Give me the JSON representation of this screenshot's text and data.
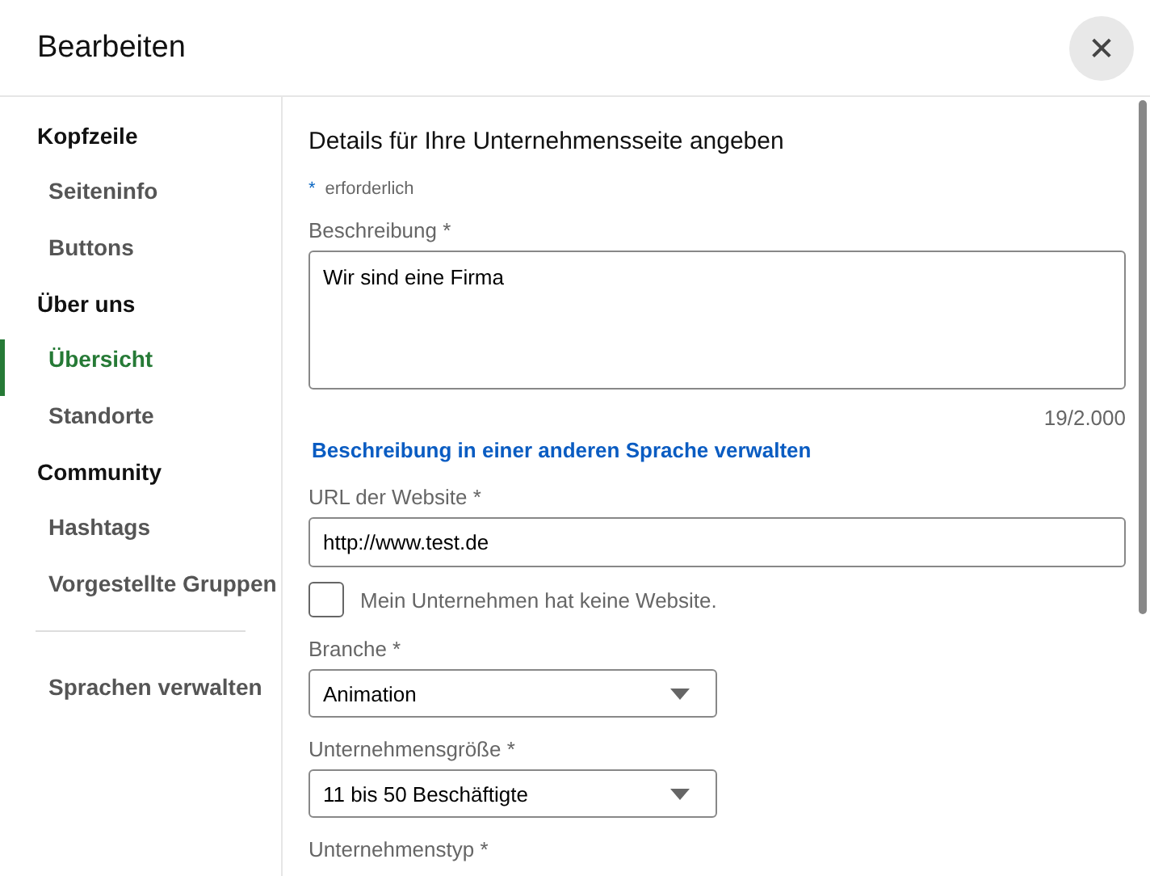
{
  "dialog": {
    "title": "Bearbeiten",
    "close": "✕"
  },
  "sidebar": {
    "items": [
      {
        "kind": "heading",
        "label": "Kopfzeile"
      },
      {
        "kind": "item",
        "label": "Seiteninfo",
        "selected": false
      },
      {
        "kind": "item",
        "label": "Buttons",
        "selected": false
      },
      {
        "kind": "heading",
        "label": "Über uns"
      },
      {
        "kind": "item",
        "label": "Übersicht",
        "selected": true
      },
      {
        "kind": "item",
        "label": "Standorte",
        "selected": false
      },
      {
        "kind": "heading",
        "label": "Community"
      },
      {
        "kind": "item",
        "label": "Hashtags",
        "selected": false
      },
      {
        "kind": "item",
        "label": "Vorgestellte Gruppen",
        "selected": false
      },
      {
        "kind": "divider"
      },
      {
        "kind": "item",
        "label": "Sprachen verwalten",
        "selected": false
      }
    ]
  },
  "form": {
    "title": "Details für Ihre Unternehmensseite angeben",
    "required_note": {
      "mark": "*",
      "text": "erforderlich"
    },
    "fields": [
      {
        "kind": "textarea",
        "label": "Beschreibung",
        "required": "*",
        "value": "Wir sind eine Firma",
        "counter": "19/2.000"
      },
      {
        "kind": "link",
        "text": "Beschreibung in einer anderen Sprache verwalten"
      },
      {
        "kind": "text",
        "label": "URL der Website",
        "required": "*",
        "value": "http://www.test.de"
      },
      {
        "kind": "checkbox",
        "label": "Mein Unternehmen hat keine Website.",
        "checked": false
      },
      {
        "kind": "select",
        "label": "Branche",
        "required": "*",
        "value": "Animation"
      },
      {
        "kind": "select",
        "label": "Unternehmensgröße",
        "required": "*",
        "value": "11 bis 50 Beschäftigte"
      },
      {
        "kind": "label",
        "label": "Unternehmenstyp",
        "required": "*"
      }
    ]
  }
}
